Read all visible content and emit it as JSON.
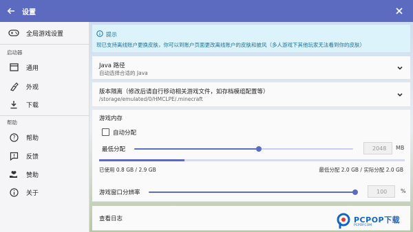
{
  "window": {
    "title": "设置"
  },
  "sidebar": {
    "global": "全局游戏设置",
    "section_launcher": "启动器",
    "items_launcher": [
      "通用",
      "外观",
      "下载"
    ],
    "section_help": "帮助",
    "items_help": [
      "帮助",
      "反馈",
      "赞助",
      "关于"
    ]
  },
  "tip": {
    "title": "提示",
    "text": "现已支持离线账户更换皮肤，你可以到账户页面更改离线账户的皮肤和披风（多人游戏下其他玩家无法看到你的皮肤）"
  },
  "java": {
    "title": "Java 路径",
    "subtitle": "自动选择合适的 Java"
  },
  "isolation": {
    "title": "版本隔离（修改后请自行移动相关游戏文件，如存档模组配置等）",
    "path": "/storage/emulated/0/HMCLPE/.minecraft"
  },
  "memory": {
    "section": "游戏内存",
    "auto_label": "自动分配",
    "min_label": "最低分配",
    "min_value": "2048",
    "unit": "MB",
    "slider_fraction": 0.57,
    "used_text": "已使用 0.8 GB / 2.9 GB",
    "alloc_text": "最低分配 2.0 GB / 实际分配 2.0 GB",
    "used_fraction": 0.28
  },
  "resolution": {
    "label": "游戏窗口分辨率",
    "value": "100",
    "unit": "%",
    "slider_fraction": 1.0
  },
  "log": {
    "label": "查看日志"
  },
  "watermark": {
    "brand": "PCPOP下载",
    "sub": "PCPOP.COM"
  },
  "colors": {
    "primary": "#5c6bc0",
    "tip_bg": "#ddf3fb",
    "tip_text": "#1b6f9d"
  }
}
